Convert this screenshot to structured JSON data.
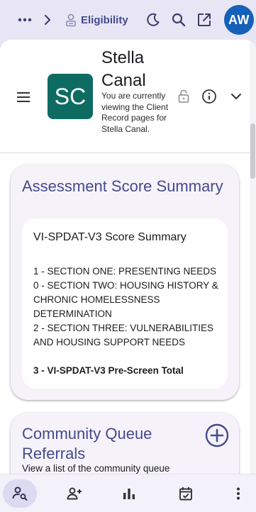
{
  "topbar": {
    "more_icon": "more-horiz-icon",
    "chevron_icon": "chevron-right-icon",
    "breadcrumb_icon": "person-badge-icon",
    "breadcrumb_label": "Eligibility",
    "theme_icon": "moon-icon",
    "search_icon": "search-icon",
    "launch_icon": "open-in-new-icon",
    "user_initials": "AW"
  },
  "client": {
    "initials": "SC",
    "name": "Stella Canal",
    "description": "You are currently viewing the Client Record pages for Stella Canal.",
    "lock_icon": "lock-icon",
    "info_icon": "info-icon",
    "expand_icon": "expand-more-icon"
  },
  "assessment": {
    "title": "Assessment Score Summary",
    "summary_title": "VI-SPDAT-V3 Score Summary",
    "lines": [
      "1 - SECTION ONE: PRESENTING NEEDS",
      "0 - SECTION TWO: HOUSING HISTORY & CHRONIC HOMELESSNESS DETERMINATION",
      "2 - SECTION THREE: VULNERABILITIES AND HOUSING SUPPORT NEEDS"
    ],
    "total": "3 - VI-SPDAT-V3 Pre-Screen Total"
  },
  "community_queue": {
    "title": "Community Queue Referrals",
    "description": "View a list of the community queue",
    "add_icon": "add-circle-icon"
  },
  "bottom_nav": {
    "items": [
      "person-search-icon",
      "person-add-icon",
      "bar-chart-icon",
      "calendar-check-icon",
      "more-vert-icon"
    ],
    "active_index": 0
  },
  "colors": {
    "accent": "#454a8e",
    "user_avatar": "#1560b8",
    "client_avatar": "#0e6b62",
    "page_background": "#e8e6f5",
    "card_background": "#f5f3f9"
  }
}
